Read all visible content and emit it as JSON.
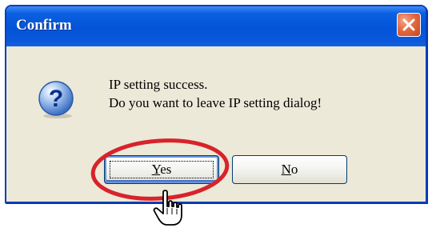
{
  "dialog": {
    "title": "Confirm",
    "message_lines": [
      "IP setting success.",
      "Do you want to leave IP setting dialog!"
    ],
    "icon": "question-icon",
    "buttons": {
      "yes": {
        "mnemonic": "Y",
        "rest": "es"
      },
      "no": {
        "mnemonic": "N",
        "rest": "o"
      }
    },
    "close_icon": "close-icon"
  },
  "overlay": {
    "highlight": "red-ellipse-around-yes-button",
    "cursor_icon": "hand-pointer-icon"
  },
  "colors": {
    "titlebar": "#0454d8",
    "dialog_bg": "#ece9d8",
    "close_button": "#e56f47",
    "highlight_red": "#d8232a"
  }
}
